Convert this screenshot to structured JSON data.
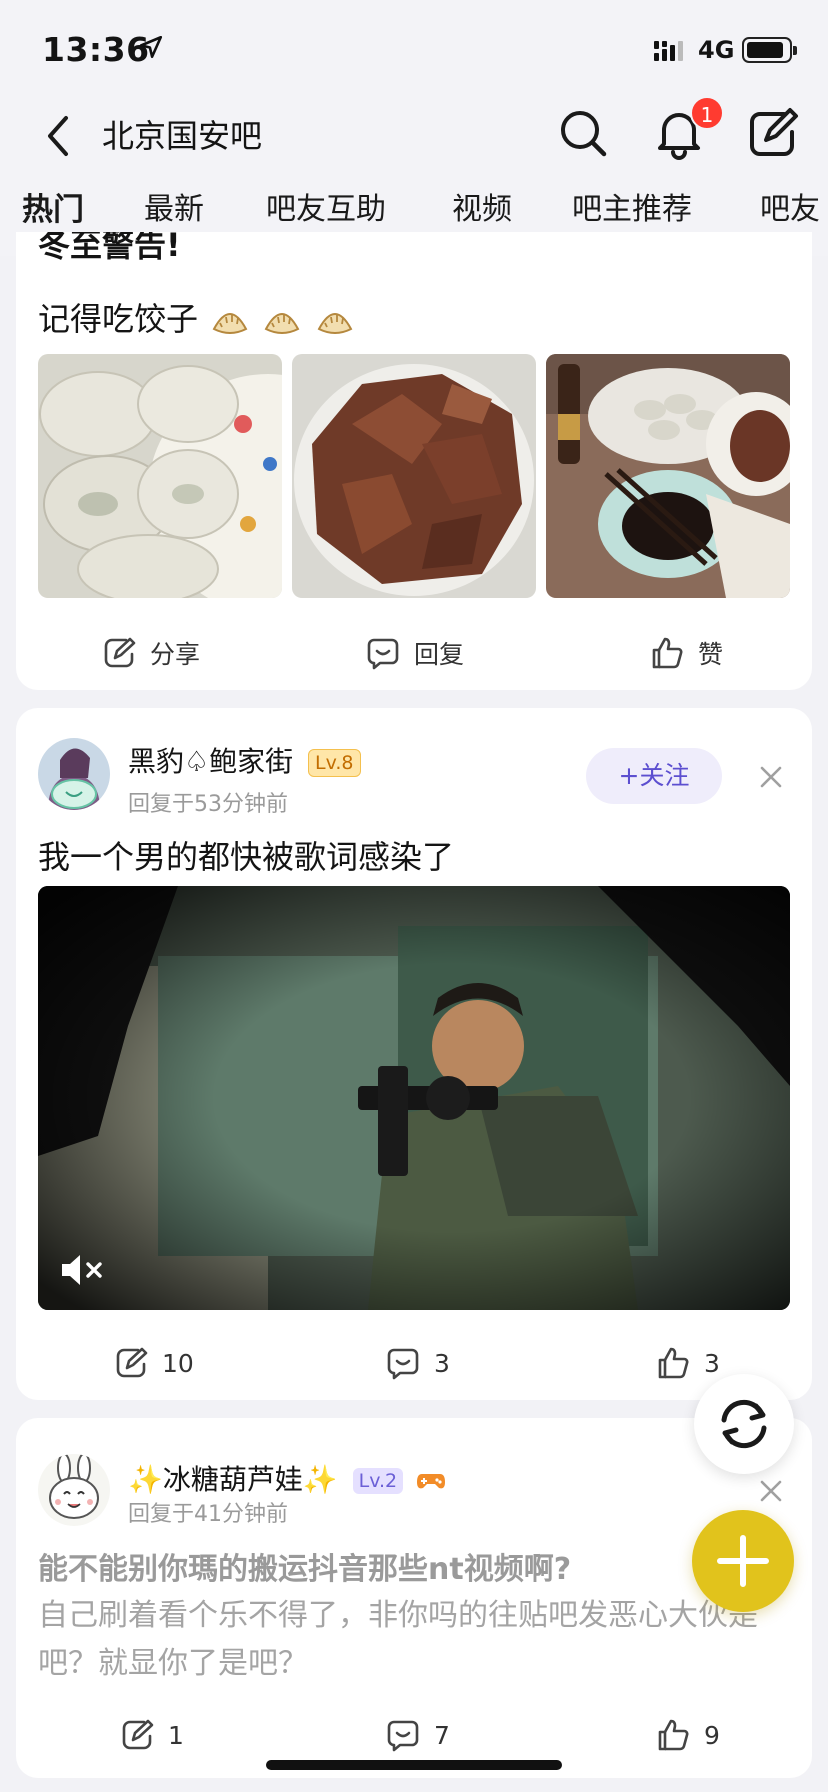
{
  "status_bar": {
    "time": "13:36",
    "network": "4G"
  },
  "header": {
    "title": "北京国安吧",
    "notification_count": "1"
  },
  "tabs": [
    {
      "label": "热门",
      "active": true
    },
    {
      "label": "最新"
    },
    {
      "label": "吧友互助"
    },
    {
      "label": "视频"
    },
    {
      "label": "吧主推荐"
    },
    {
      "label": "吧友"
    }
  ],
  "post1": {
    "title": "冬至警告!",
    "body": "记得吃饺子",
    "images": [
      "dumplings-plate",
      "braised-meat",
      "dinner-table"
    ],
    "actions": {
      "share": "分享",
      "reply": "回复",
      "like": "赞"
    }
  },
  "post2": {
    "username": "黑豹♤鲍家街",
    "level": "Lv.8",
    "meta": "回复于53分钟前",
    "follow_label": "+关注",
    "body": "我一个男的都快被歌词感染了",
    "video": "soldier-aiming-rifle",
    "actions": {
      "share": "10",
      "reply": "3",
      "like": "3"
    }
  },
  "post3": {
    "username": "✨冰糖葫芦娃✨",
    "level": "Lv.2",
    "meta": "回复于41分钟前",
    "title": "能不能别你瑪的搬运抖音那些nt视频啊?",
    "body": "自己刷着看个乐不得了，非你吗的往贴吧发恶心大伙是吧？就显你了是吧？",
    "actions": {
      "share": "1",
      "reply": "7",
      "like": "9"
    }
  },
  "colors": {
    "accent": "#e1c31c",
    "badge": "#ff3b30",
    "follow": "#5c4fd0"
  }
}
